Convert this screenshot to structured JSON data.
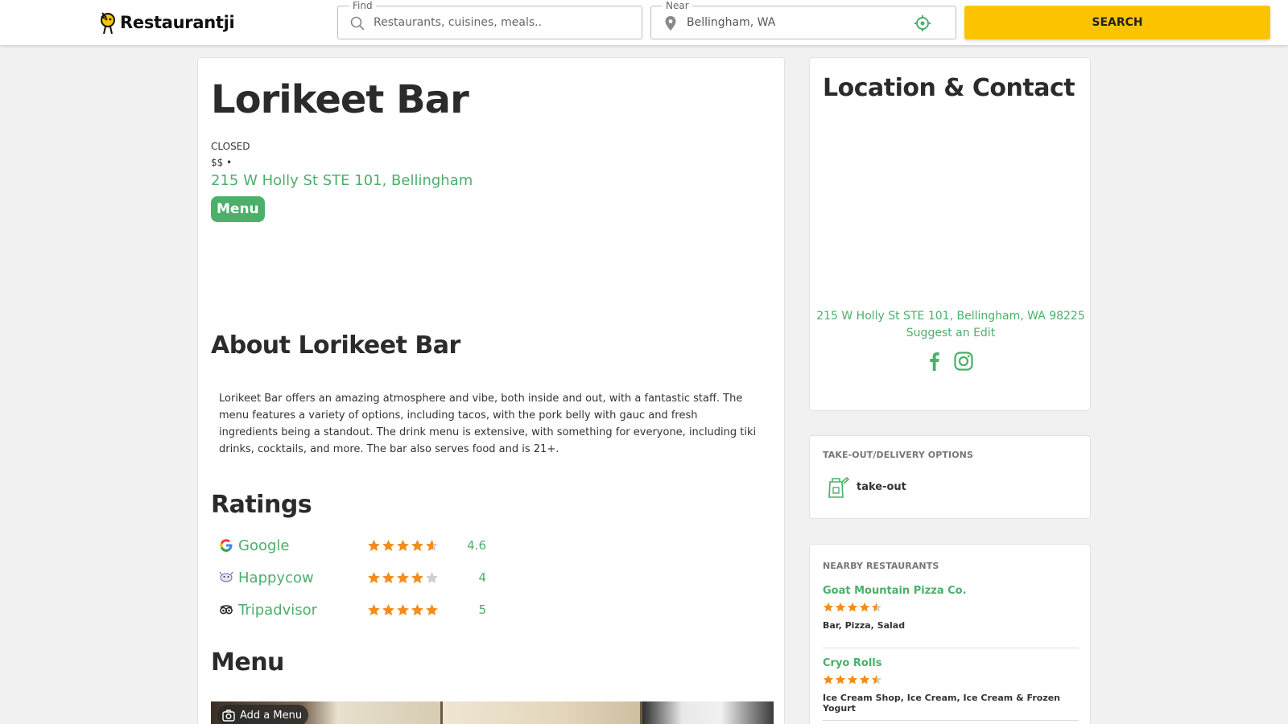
{
  "header": {
    "logo_text": "Restaurantji",
    "find_legend": "Find",
    "find_placeholder": "Restaurants, cuisines, meals..",
    "near_legend": "Near",
    "near_value": "Bellingham, WA",
    "search_label": "SEARCH"
  },
  "restaurant": {
    "name": "Lorikeet Bar",
    "status": "CLOSED",
    "price": "$$ •",
    "address": "215 W Holly St STE 101, Bellingham",
    "menu_button": "Menu"
  },
  "about": {
    "heading": "About Lorikeet Bar",
    "text": "Lorikeet Bar offers an amazing atmosphere and vibe, both inside and out, with a fantastic staff. The menu features a variety of options, including tacos, with the pork belly with gauc and fresh ingredients being a standout. The drink menu is extensive, with something for everyone, including tiki drinks, cocktails, and more. The bar also serves food and is 21+."
  },
  "ratings": {
    "heading": "Ratings",
    "items": [
      {
        "source": "Google",
        "value": "4.6",
        "stars": 4.6
      },
      {
        "source": "Happycow",
        "value": "4",
        "stars": 4
      },
      {
        "source": "Tripadvisor",
        "value": "5",
        "stars": 5
      }
    ]
  },
  "menu_section": {
    "heading": "Menu",
    "add_menu": "Add a Menu"
  },
  "location": {
    "heading": "Location & Contact",
    "full_address": "215 W Holly St STE 101, Bellingham, WA 98225",
    "suggest_edit": "Suggest an Edit"
  },
  "takeout": {
    "label": "TAKE-OUT/DELIVERY OPTIONS",
    "option": "take-out"
  },
  "nearby": {
    "label": "NEARBY RESTAURANTS",
    "items": [
      {
        "name": "Goat Mountain Pizza Co.",
        "stars": 4.5,
        "tags": "Bar, Pizza, Salad"
      },
      {
        "name": "Cryo Rolls",
        "stars": 4.5,
        "tags": "Ice Cream Shop, Ice Cream, Ice Cream & Frozen Yogurt"
      }
    ]
  },
  "colors": {
    "accent_green": "#4caf6a",
    "search_yellow": "#fcc400",
    "star_orange": "#f28c1b",
    "star_empty": "#cfcfcf"
  }
}
